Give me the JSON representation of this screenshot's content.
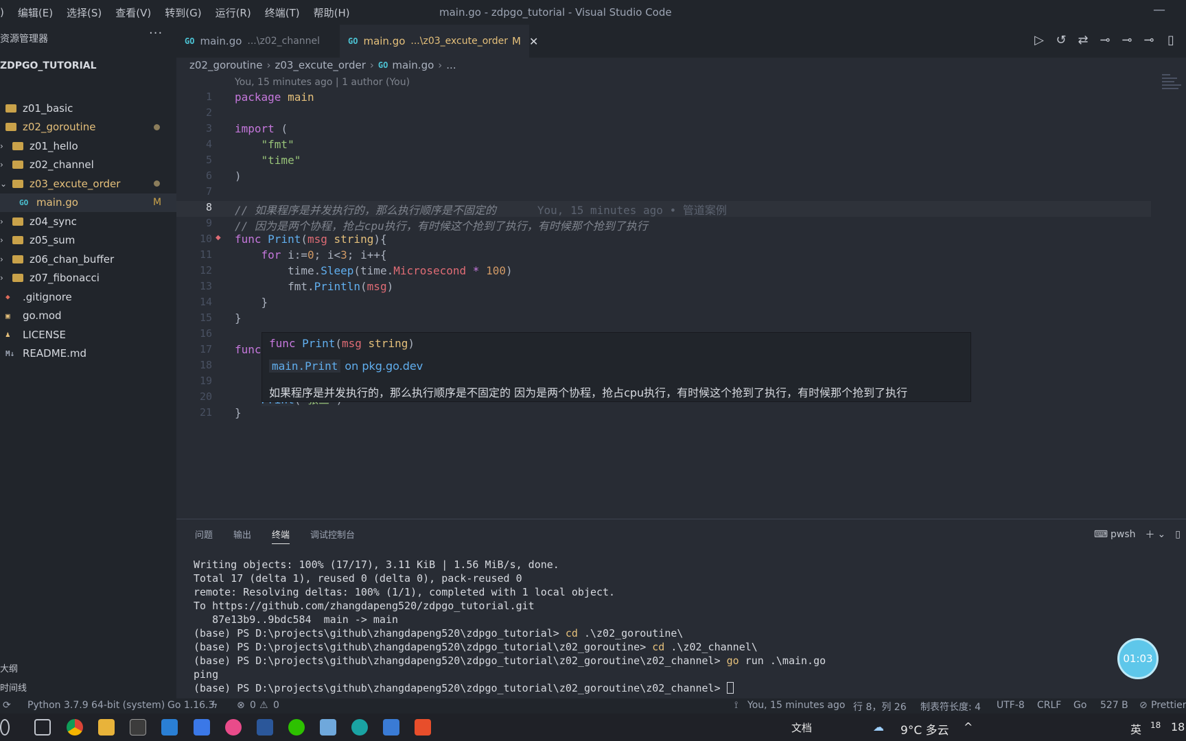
{
  "menu": [
    "编辑(E)",
    "选择(S)",
    "查看(V)",
    "转到(G)",
    "运行(R)",
    "终端(T)",
    "帮助(H)"
  ],
  "menu_lead": ")",
  "window_title": "main.go - zdpgo_tutorial - Visual Studio Code",
  "sidebar": {
    "header": "资源管理器",
    "root": "ZDPGO_TUTORIAL",
    "items": [
      {
        "label": "z01_basic",
        "type": "folder",
        "color": "#d7dae0"
      },
      {
        "label": "z02_goroutine",
        "type": "folder",
        "color": "#e5c07b",
        "modified_dot": true
      },
      {
        "label": "z01_hello",
        "type": "folder",
        "color": "#d7dae0"
      },
      {
        "label": "z02_channel",
        "type": "folder",
        "color": "#d7dae0"
      },
      {
        "label": "z03_excute_order",
        "type": "folder",
        "color": "#e5c07b",
        "modified_dot": true
      },
      {
        "label": "main.go",
        "type": "go",
        "color": "#e5c07b",
        "mark": "M"
      },
      {
        "label": "z04_sync",
        "type": "folder",
        "color": "#d7dae0"
      },
      {
        "label": "z05_sum",
        "type": "folder",
        "color": "#d7dae0"
      },
      {
        "label": "z06_chan_buffer",
        "type": "folder",
        "color": "#d7dae0"
      },
      {
        "label": "z07_fibonacci",
        "type": "folder",
        "color": "#d7dae0"
      },
      {
        "label": ".gitignore",
        "type": "git",
        "color": "#d7dae0"
      },
      {
        "label": "go.mod",
        "type": "mod",
        "color": "#d7dae0"
      },
      {
        "label": "LICENSE",
        "type": "license",
        "color": "#d7dae0"
      },
      {
        "label": "README.md",
        "type": "md",
        "color": "#d7dae0"
      }
    ],
    "outline": "大纲",
    "timeline": "时间线"
  },
  "tabs": [
    {
      "name": "main.go",
      "path": "...\\z02_channel",
      "active": false
    },
    {
      "name": "main.go",
      "path": "...\\z03_excute_order",
      "mark": "M",
      "active": true
    }
  ],
  "breadcrumb": [
    "z02_goroutine",
    "z03_excute_order",
    "main.go",
    "..."
  ],
  "codelens": "You, 15 minutes ago | 1 author (You)",
  "blame": "You, 15 minutes ago • 管道案例",
  "code": {
    "l1_kw": "package",
    "l1_name": "main",
    "l3_kw": "import",
    "l3_paren": "(",
    "l4": "\"fmt\"",
    "l5": "\"time\"",
    "l6": ")",
    "l8": "// 如果程序是并发执行的，那么执行顺序是不固定的",
    "l9": "// 因为是两个协程，抢占cpu执行，有时候这个抢到了执行，有时候那个抢到了执行",
    "l10_kw": "func",
    "l10_fn": "Print",
    "l10_p": "msg",
    "l10_ty": "string",
    "l11_kw": "for",
    "l11_var": "i",
    "l11_rest_a": ":=",
    "l11_n0": "0",
    "l11_rest_b": "; i<",
    "l11_n3": "3",
    "l11_rest_c": "; i++{",
    "l12_a": "time.",
    "l12_fn": "Sleep",
    "l12_b": "(time.",
    "l12_c": "Microsecond",
    "l12_op": " * ",
    "l12_n": "100",
    "l12_d": ")",
    "l13_a": "fmt.",
    "l13_fn": "Println",
    "l13_b": "(",
    "l13_v": "msg",
    "l13_c": ")",
    "l14": "}",
    "l15": "}",
    "l17_kw": "func",
    "l20_fn": "Print",
    "l20_b": "(",
    "l20_s": "\"张三\"",
    "l20_c": ")",
    "l21": "}"
  },
  "hover": {
    "sig_kw": "func",
    "sig_fn": "Print",
    "sig_p": "msg",
    "sig_ty": "string",
    "link_code": "main.Print",
    "link_text": "on pkg.go.dev",
    "doc": "如果程序是并发执行的，那么执行顺序是不固定的 因为是两个协程，抢占cpu执行，有时候这个抢到了执行，有时候那个抢到了执行"
  },
  "panel": {
    "tabs": [
      "问题",
      "输出",
      "终端",
      "调试控制台"
    ],
    "active_tab": "终端",
    "shell": "pwsh",
    "terminal": [
      "Writing objects: 100% (17/17), 3.11 KiB | 1.56 MiB/s, done.",
      "Total 17 (delta 1), reused 0 (delta 0), pack-reused 0",
      "remote: Resolving deltas: 100% (1/1), completed with 1 local object.",
      "To https://github.com/zhangdapeng520/zdpgo_tutorial.git",
      "   87e13b9..9bdc584  main -> main"
    ],
    "prompts": [
      {
        "prompt": "(base) PS D:\\projects\\github\\zhangdapeng520\\zdpgo_tutorial> ",
        "cmd": "cd",
        "arg": " .\\z02_goroutine\\"
      },
      {
        "prompt": "(base) PS D:\\projects\\github\\zhangdapeng520\\zdpgo_tutorial\\z02_goroutine> ",
        "cmd": "cd",
        "arg": " .\\z02_channel\\"
      },
      {
        "prompt": "(base) PS D:\\projects\\github\\zhangdapeng520\\zdpgo_tutorial\\z02_goroutine\\z02_channel> ",
        "cmd": "go",
        "arg": " run .\\main.go"
      }
    ],
    "output": "ping",
    "last_prompt": "(base) PS D:\\projects\\github\\zhangdapeng520\\zdpgo_tutorial\\z02_goroutine\\z02_channel> "
  },
  "timer": "01:03",
  "status": {
    "python": "Python 3.7.9 64-bit (system)",
    "go": "Go 1.16.3",
    "errors": "0",
    "warnings": "0",
    "blame": "You, 15 minutes ago",
    "position": "行 8，列 26",
    "tab": "制表符长度: 4",
    "encoding": "UTF-8",
    "eol": "CRLF",
    "lang": "Go",
    "size": "527 B",
    "prettier": "Prettier"
  },
  "taskbar": {
    "doc": "文档",
    "weather": "9°C 多云",
    "ime": "英",
    "day": "18",
    "clock_partial": "18"
  }
}
